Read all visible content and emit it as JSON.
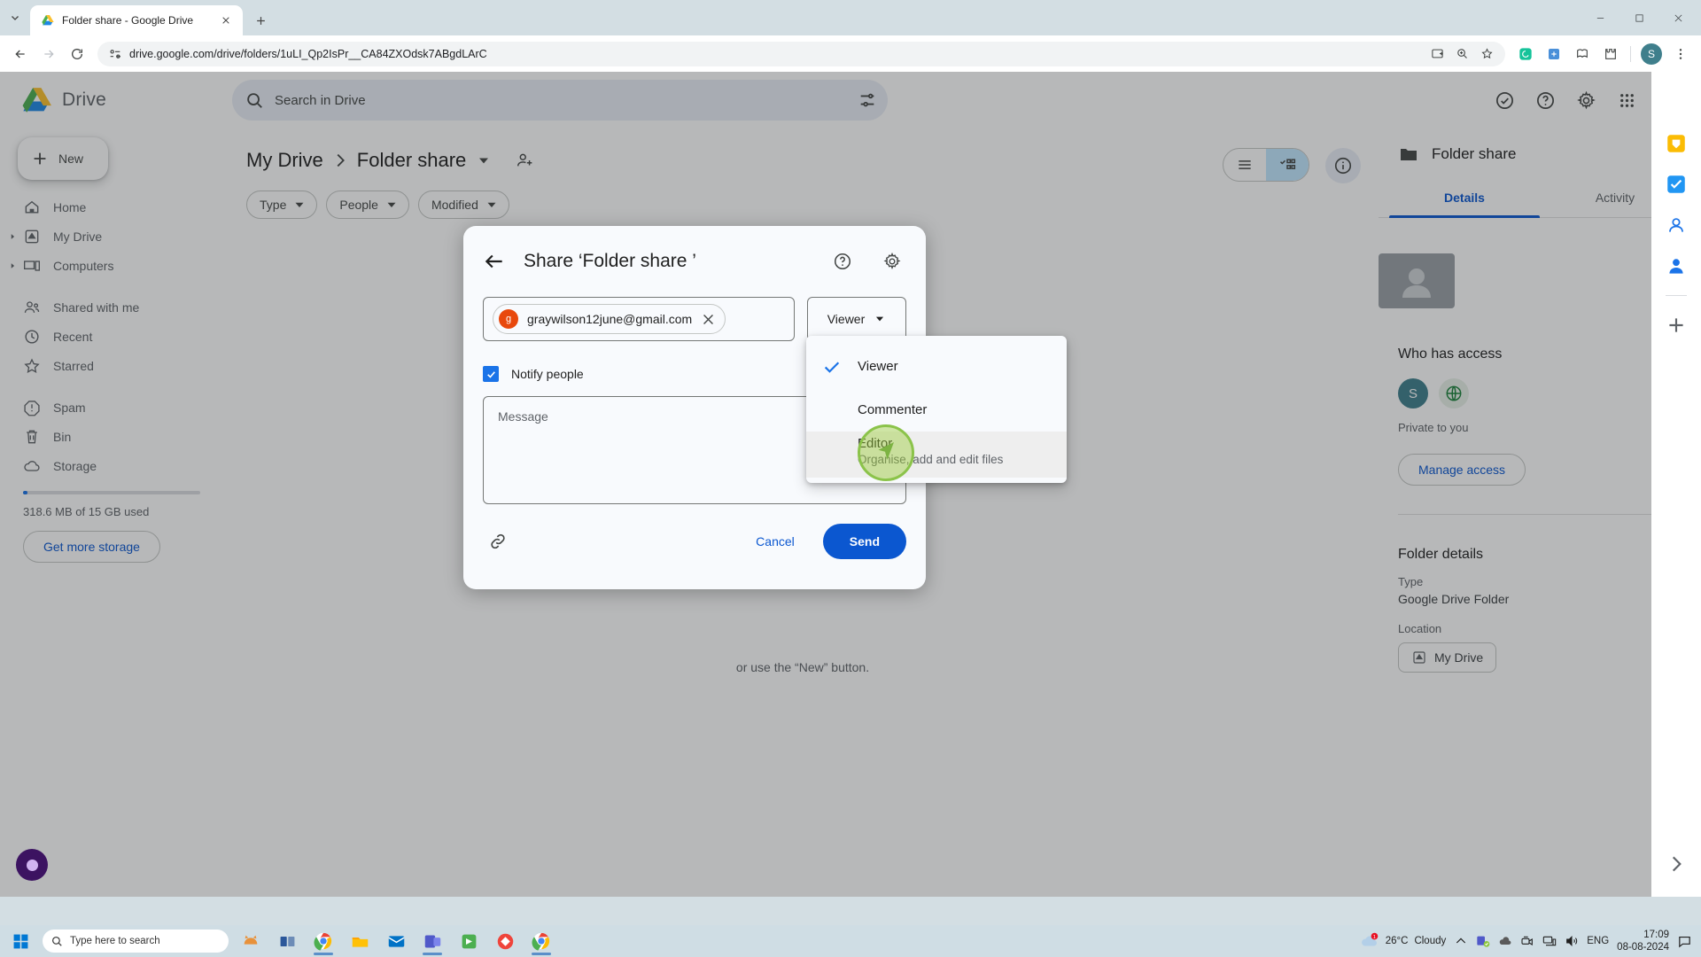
{
  "browser": {
    "tab": {
      "title": "Folder share - Google Drive",
      "favicon": "drive-icon",
      "close_icon": "close-icon"
    },
    "new_tab_label": "+",
    "url": "drive.google.com/drive/folders/1uLI_Qp2IsPr__CA84ZXOdsk7ABgdLArC",
    "profile_initial": "S",
    "window_controls": {
      "minimize": "minimize-icon",
      "maximize": "maximize-icon",
      "close": "close-icon"
    }
  },
  "drive": {
    "logo_text": "Drive",
    "search": {
      "placeholder": "Search in Drive",
      "search_icon": "search-icon",
      "tune_icon": "tune-icon"
    },
    "header_icons": [
      "support-icon",
      "help-icon",
      "settings-icon",
      "apps-grid-icon"
    ],
    "account_initial": "S",
    "sidebar": {
      "new_button": "New",
      "items": [
        {
          "label": "Home",
          "icon": "home-icon",
          "expandable": false
        },
        {
          "label": "My Drive",
          "icon": "drive-icon",
          "expandable": true
        },
        {
          "label": "Computers",
          "icon": "computer-icon",
          "expandable": true
        },
        {
          "label": "Shared with me",
          "icon": "people-icon",
          "expandable": false
        },
        {
          "label": "Recent",
          "icon": "clock-icon",
          "expandable": false
        },
        {
          "label": "Starred",
          "icon": "star-icon",
          "expandable": false
        },
        {
          "label": "Spam",
          "icon": "spam-icon",
          "expandable": false
        },
        {
          "label": "Bin",
          "icon": "trash-icon",
          "expandable": false
        },
        {
          "label": "Storage",
          "icon": "cloud-icon",
          "expandable": false
        }
      ],
      "storage_text": "318.6 MB of 15 GB used",
      "storage_percent": 2,
      "get_more_storage": "Get more storage"
    },
    "breadcrumb": {
      "root": "My Drive",
      "current": "Folder share",
      "share_icon": "add-people-icon"
    },
    "filters": [
      {
        "label": "Type",
        "icon": "chevron-down-icon"
      },
      {
        "label": "People",
        "icon": "chevron-down-icon"
      },
      {
        "label": "Modified",
        "icon": "chevron-down-icon"
      }
    ],
    "view_toggle": {
      "list": "list-view-icon",
      "grid": "grid-view-icon",
      "active": "grid"
    },
    "info_button": "info-icon",
    "empty_hint": "or use the “New” button."
  },
  "details_panel": {
    "title": "Folder share",
    "close_icon": "close-icon",
    "folder_icon": "folder-icon",
    "tabs": [
      {
        "label": "Details",
        "active": true
      },
      {
        "label": "Activity",
        "active": false
      }
    ],
    "who_has_access_heading": "Who has access",
    "owner_initial": "S",
    "access_note": "Private to you",
    "manage_access": "Manage access",
    "folder_details_heading": "Folder details",
    "type_label": "Type",
    "type_value": "Google Drive Folder",
    "location_label": "Location",
    "location_value": "My Drive"
  },
  "share_dialog": {
    "back_icon": "back-arrow-icon",
    "title": "Share ‘Folder share ’",
    "help_icon": "help-icon",
    "settings_icon": "gear-icon",
    "recipient": {
      "email": "graywilson12june@gmail.com",
      "avatar_letter": "g",
      "remove_icon": "close-icon"
    },
    "role_selector": {
      "value": "Viewer",
      "caret": "chevron-down-icon"
    },
    "notify_people": {
      "label": "Notify people",
      "checked": true
    },
    "message_placeholder": "Message",
    "copy_link_icon": "link-icon",
    "cancel_label": "Cancel",
    "send_label": "Send"
  },
  "role_menu": {
    "items": [
      {
        "label": "Viewer",
        "subtitle": "",
        "checked": true,
        "highlighted": false
      },
      {
        "label": "Commenter",
        "subtitle": "",
        "checked": false,
        "highlighted": false
      },
      {
        "label": "Editor",
        "subtitle": "Organise, add and edit files",
        "checked": false,
        "highlighted": true
      }
    ]
  },
  "taskbar": {
    "search_placeholder": "Type here to search",
    "weather": {
      "temp": "26°C",
      "condition": "Cloudy",
      "badge": "1"
    },
    "language": "ENG",
    "time": "17:09",
    "date": "08-08-2024",
    "apps": [
      "task-view-icon",
      "chrome-icon",
      "file-explorer-icon",
      "outlook-icon",
      "teams-icon",
      "store-icon",
      "anydesk-icon",
      "chrome-icon"
    ]
  },
  "colors": {
    "accent_blue": "#0b57d0",
    "checkbox_blue": "#1a73e8",
    "cursor_green": "#8bc34a",
    "avatar_teal": "#3f7f8c",
    "gmail_orange": "#e8480c"
  }
}
